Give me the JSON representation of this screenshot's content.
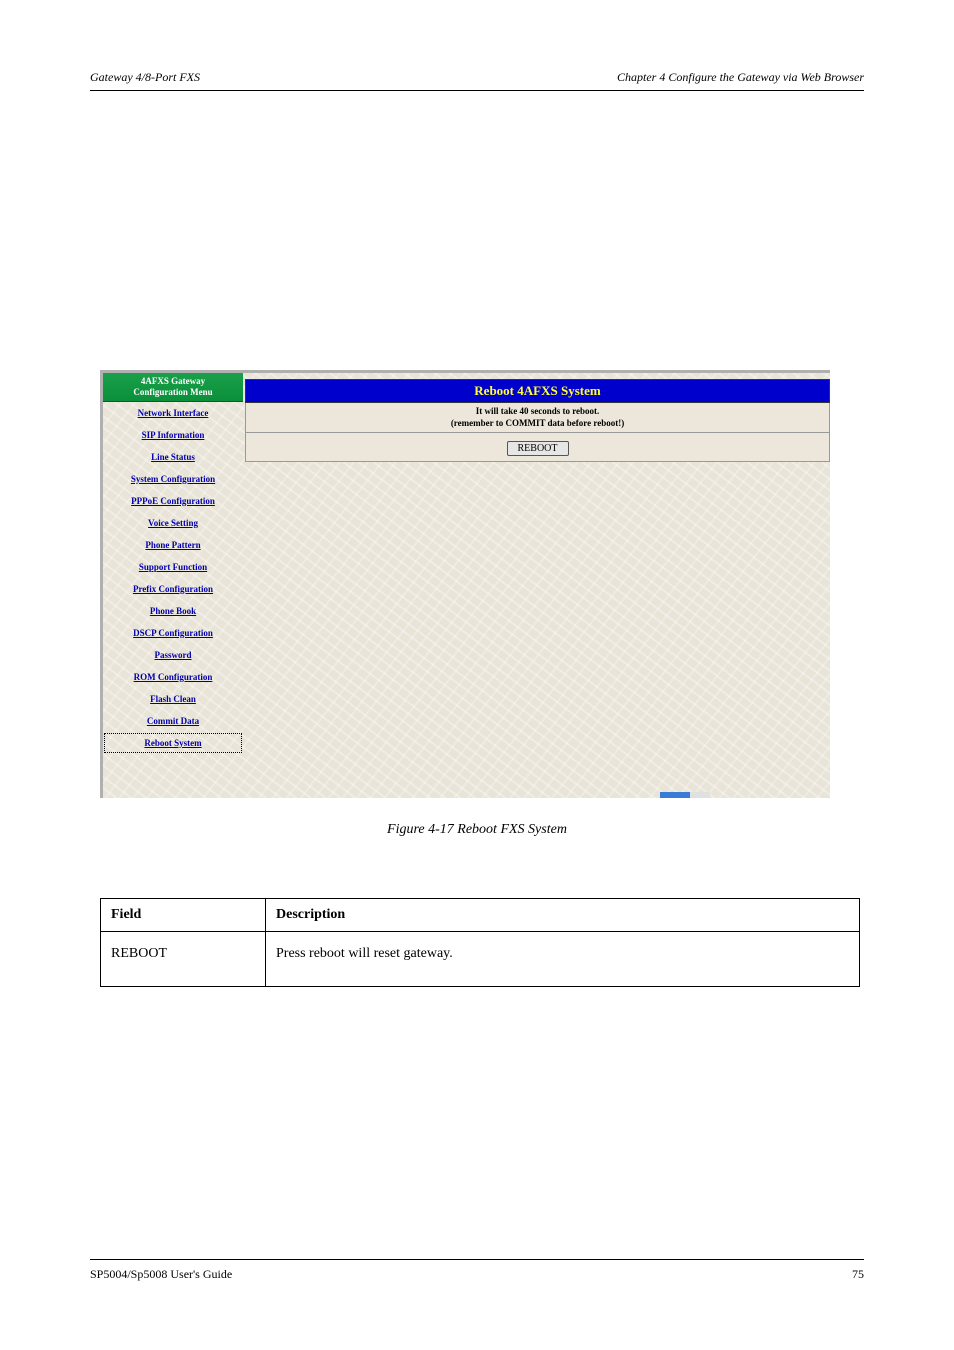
{
  "header": {
    "left": "Gateway 4/8-Port FXS",
    "right": "Chapter 4 Configure the Gateway via Web Browser"
  },
  "footer": {
    "left": "SP5004/Sp5008 User's Guide",
    "right": "75"
  },
  "screenshot": {
    "sidebar": {
      "title_line1": "4AFXS Gateway",
      "title_line2": "Configuration Menu",
      "items": [
        "Network Interface",
        "SIP Information",
        "Line Status",
        "System Configuration",
        "PPPoE Configuration",
        "Voice Setting",
        "Phone Pattern",
        "Support Function",
        "Prefix Configuration",
        "Phone Book",
        "DSCP Configuration",
        "Password",
        "ROM Configuration",
        "Flash Clean",
        "Commit Data",
        "Reboot System"
      ]
    },
    "main": {
      "title": "Reboot 4AFXS System",
      "notice_line1": "It will take 40 seconds to reboot.",
      "notice_line2": "(remember to COMMIT data before reboot!)",
      "button": "REBOOT"
    }
  },
  "caption": "Figure 4-17 Reboot FXS System",
  "table": {
    "head_field": "Field",
    "head_desc": "Description",
    "row1_field": "REBOOT",
    "row1_desc": "Press reboot will reset gateway."
  }
}
